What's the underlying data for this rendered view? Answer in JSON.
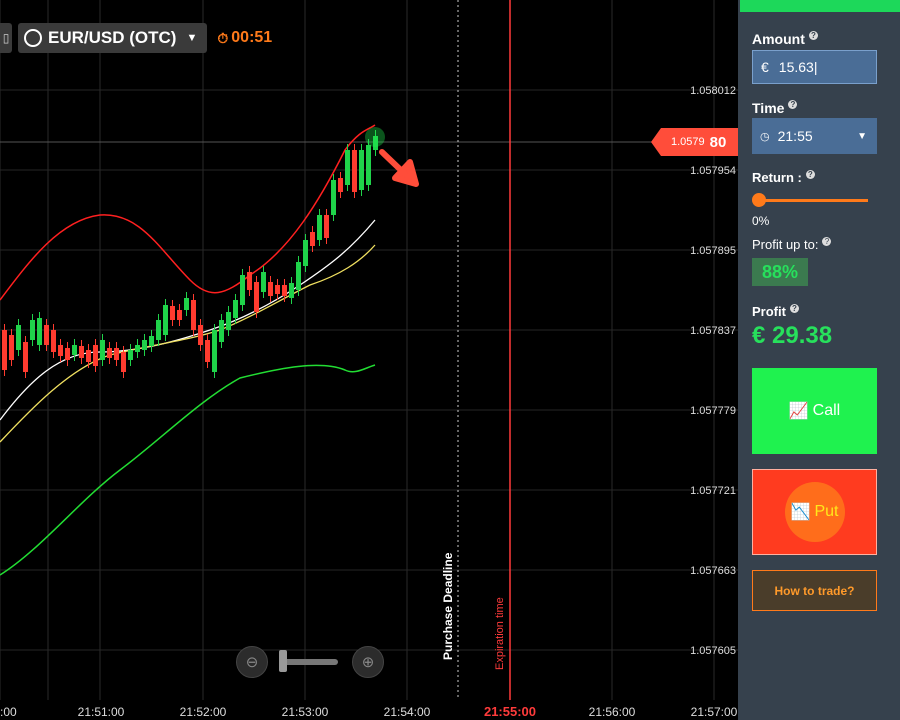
{
  "header": {
    "asset_label": "EUR/USD (OTC)",
    "timer": "00:51"
  },
  "chart": {
    "price_levels": [
      "1.058012",
      "1.057954",
      "1.057895",
      "1.057837",
      "1.057779",
      "1.057721",
      "1.057663",
      "1.057605"
    ],
    "time_labels": [
      "21:51:00",
      "21:52:00",
      "21:53:00",
      "21:54:00",
      "21:55:00",
      "21:56:00",
      "21:57:00"
    ],
    "time_label_left": ":00",
    "current_price_small": "1.0579",
    "current_price_big": "80",
    "purchase_deadline_label": "Purchase Deadline",
    "expiration_label": "Expiration time",
    "colors": {
      "up": "#1fd34a",
      "down": "#ff3b2f",
      "upper_band": "#ff2020",
      "lower_band": "#22dd33",
      "ma_white": "#ffffff",
      "ma_yellow": "#f0e060",
      "expiry_line": "#ff3b3b",
      "price_line": "#555555"
    }
  },
  "panel": {
    "amount_label": "Amount",
    "amount_currency": "€",
    "amount_value": "15.63",
    "time_label": "Time",
    "time_value": "21:55",
    "return_label": "Return :",
    "return_value": "0%",
    "profit_up_label": "Profit up to:",
    "profit_up_value": "88%",
    "profit_label": "Profit",
    "profit_value": "€ 29.38",
    "call_label": "Call",
    "put_label": "Put",
    "howto_label": "How to trade?",
    "accent_green": "#1ff24f",
    "accent_red": "#ff3b1f",
    "accent_orange": "#ff7a1a"
  }
}
